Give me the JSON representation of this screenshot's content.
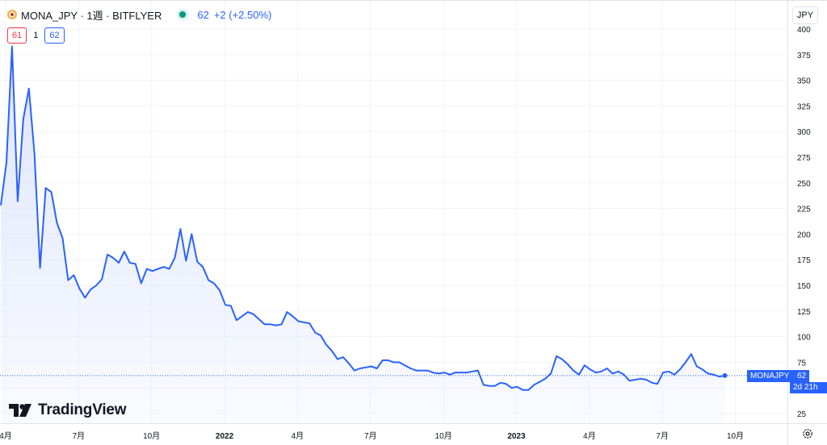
{
  "header": {
    "symbol": "MONA_JPY · 1週 · BITFLYER",
    "last": "62",
    "change": "+2 (+2.50%)",
    "low_box": "61",
    "mid_value": "1",
    "high_box": "62"
  },
  "currency_button": "JPY",
  "watermark": "TradingView",
  "last_price_tag": {
    "name": "MONAJPY",
    "price": "62",
    "countdown": "2d 21h"
  },
  "colors": {
    "line": "#2962ff",
    "fill_top": "#dce4fb",
    "grid": "#f0f3fa",
    "axis_text": "#131722",
    "border": "#e0e3eb",
    "last_line": "#2962ff",
    "up": "#089981",
    "down": "#f23645"
  },
  "icons": [
    "coin-icon",
    "live-dot-icon",
    "tradingview-logo-icon",
    "settings-gear-icon"
  ],
  "chart_data": {
    "type": "area",
    "title": "MONA_JPY · 1週 · BITFLYER",
    "xlabel": "",
    "ylabel": "",
    "ylim": [
      10,
      400
    ],
    "y_ticks": [
      25,
      50,
      75,
      100,
      125,
      150,
      175,
      200,
      225,
      250,
      275,
      300,
      325,
      350,
      375,
      400
    ],
    "x_ticks": [
      {
        "label": "4月",
        "bold": false,
        "i": 0
      },
      {
        "label": "7月",
        "bold": false,
        "i": 13
      },
      {
        "label": "10月",
        "bold": false,
        "i": 26
      },
      {
        "label": "2022",
        "bold": true,
        "i": 39
      },
      {
        "label": "4月",
        "bold": false,
        "i": 52
      },
      {
        "label": "7月",
        "bold": false,
        "i": 65
      },
      {
        "label": "10月",
        "bold": false,
        "i": 78
      },
      {
        "label": "2023",
        "bold": true,
        "i": 91
      },
      {
        "label": "4月",
        "bold": false,
        "i": 104
      },
      {
        "label": "7月",
        "bold": false,
        "i": 117
      },
      {
        "label": "10月",
        "bold": false,
        "i": 130
      }
    ],
    "grid": true,
    "last_value": 62,
    "series": [
      {
        "values": [
          228,
          270,
          383,
          232,
          312,
          342,
          278,
          167,
          245,
          241,
          211,
          196,
          155,
          160,
          147,
          138,
          146,
          150,
          156,
          180,
          177,
          172,
          183,
          172,
          171,
          152,
          166,
          164,
          166,
          168,
          166,
          177,
          205,
          174,
          200,
          173,
          168,
          155,
          152,
          145,
          131,
          130,
          116,
          120,
          124,
          122,
          117,
          112,
          112,
          111,
          112,
          124,
          120,
          115,
          114,
          113,
          104,
          101,
          92,
          86,
          78,
          80,
          74,
          67,
          69,
          70,
          71,
          69,
          77,
          77,
          75,
          75,
          72,
          69,
          67,
          67,
          67,
          65,
          64,
          65,
          63,
          65,
          65,
          65,
          66,
          67,
          53,
          52,
          52,
          55,
          54,
          50,
          51,
          48,
          48,
          53,
          56,
          59,
          64,
          81,
          78,
          73,
          67,
          63,
          72,
          68,
          65,
          66,
          69,
          64,
          66,
          63,
          57,
          58,
          59,
          58,
          55,
          54,
          65,
          66,
          63,
          68,
          75,
          83,
          71,
          68,
          64,
          63,
          61,
          62
        ]
      }
    ]
  }
}
